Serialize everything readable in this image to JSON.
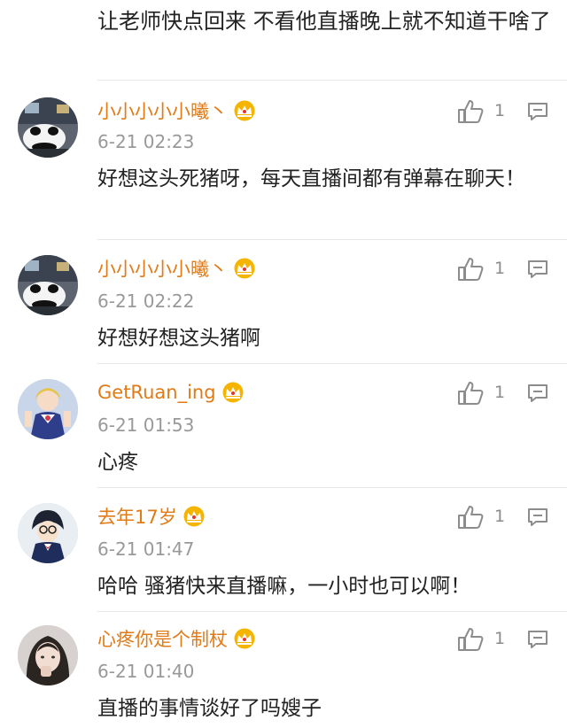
{
  "colors": {
    "name": "#e07b17",
    "time": "#999999",
    "text": "#222222",
    "icon": "#8c8c8c",
    "crown_fill": "#f5b400",
    "crown_gem": "#e5322d"
  },
  "top_text": "让老师快点回来 不看他直播晚上就不知道干啥了",
  "comments": [
    {
      "name": "小小小小小曦丶",
      "time": "6-21 02:23",
      "text": "好想这头死猪呀，每天直播间都有弹幕在聊天！",
      "likes": "1",
      "avatar": "panda-avatar"
    },
    {
      "name": "小小小小小曦丶",
      "time": "6-21 02:22",
      "text": "好想好想这头猪啊",
      "likes": "1",
      "avatar": "panda-avatar"
    },
    {
      "name": "GetRuan_ing",
      "time": "6-21 01:53",
      "text": "心疼",
      "likes": "1",
      "avatar": "anime-girl-avatar"
    },
    {
      "name": "去年17岁",
      "time": "6-21 01:47",
      "text": "哈哈 骚猪快来直播嘛，一小时也可以啊！",
      "likes": "1",
      "avatar": "anime-boy-avatar"
    },
    {
      "name": "心疼你是个制杖",
      "time": "6-21 01:40",
      "text": "直播的事情谈好了吗嫂子",
      "likes": "1",
      "avatar": "selfie-avatar"
    }
  ],
  "icons": {
    "like": "thumbs-up-icon",
    "reply": "comment-icon",
    "badge": "crown-badge-icon"
  }
}
